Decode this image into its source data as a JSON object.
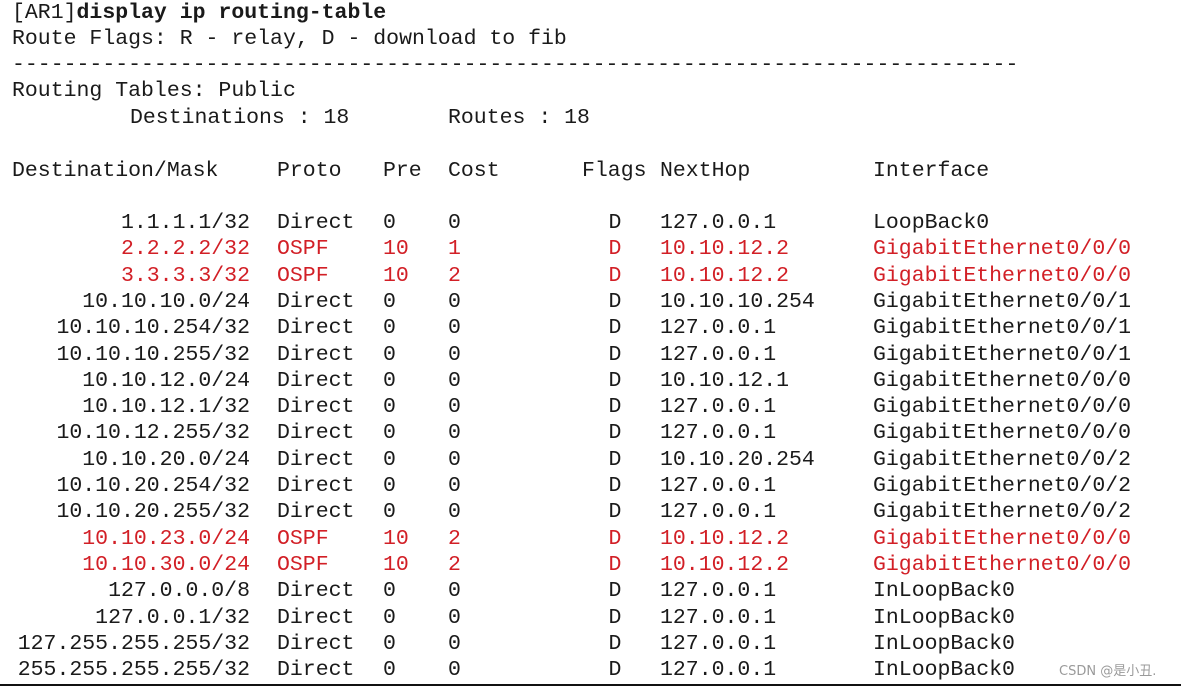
{
  "command": {
    "prompt": "[AR1]",
    "text": "display ip routing-table"
  },
  "flags_legend": "Route Flags: R - relay, D - download to fib",
  "separator": "------------------------------------------------------------------------------",
  "routing_tables_label": "Routing Tables: Public",
  "destinations_label": "Destinations : 18",
  "routes_label": "Routes : 18",
  "columns": [
    "Destination/Mask",
    "Proto",
    "Pre",
    "Cost",
    "Flags",
    "NextHop",
    "Interface"
  ],
  "rows": [
    {
      "dest": "1.1.1.1/32",
      "proto": "Direct",
      "pre": "0",
      "cost": "0",
      "flags": "D",
      "nexthop": "127.0.0.1",
      "iface": "LoopBack0",
      "highlight": false
    },
    {
      "dest": "2.2.2.2/32",
      "proto": "OSPF",
      "pre": "10",
      "cost": "1",
      "flags": "D",
      "nexthop": "10.10.12.2",
      "iface": "GigabitEthernet0/0/0",
      "highlight": true
    },
    {
      "dest": "3.3.3.3/32",
      "proto": "OSPF",
      "pre": "10",
      "cost": "2",
      "flags": "D",
      "nexthop": "10.10.12.2",
      "iface": "GigabitEthernet0/0/0",
      "highlight": true
    },
    {
      "dest": "10.10.10.0/24",
      "proto": "Direct",
      "pre": "0",
      "cost": "0",
      "flags": "D",
      "nexthop": "10.10.10.254",
      "iface": "GigabitEthernet0/0/1",
      "highlight": false
    },
    {
      "dest": "10.10.10.254/32",
      "proto": "Direct",
      "pre": "0",
      "cost": "0",
      "flags": "D",
      "nexthop": "127.0.0.1",
      "iface": "GigabitEthernet0/0/1",
      "highlight": false
    },
    {
      "dest": "10.10.10.255/32",
      "proto": "Direct",
      "pre": "0",
      "cost": "0",
      "flags": "D",
      "nexthop": "127.0.0.1",
      "iface": "GigabitEthernet0/0/1",
      "highlight": false
    },
    {
      "dest": "10.10.12.0/24",
      "proto": "Direct",
      "pre": "0",
      "cost": "0",
      "flags": "D",
      "nexthop": "10.10.12.1",
      "iface": "GigabitEthernet0/0/0",
      "highlight": false
    },
    {
      "dest": "10.10.12.1/32",
      "proto": "Direct",
      "pre": "0",
      "cost": "0",
      "flags": "D",
      "nexthop": "127.0.0.1",
      "iface": "GigabitEthernet0/0/0",
      "highlight": false
    },
    {
      "dest": "10.10.12.255/32",
      "proto": "Direct",
      "pre": "0",
      "cost": "0",
      "flags": "D",
      "nexthop": "127.0.0.1",
      "iface": "GigabitEthernet0/0/0",
      "highlight": false
    },
    {
      "dest": "10.10.20.0/24",
      "proto": "Direct",
      "pre": "0",
      "cost": "0",
      "flags": "D",
      "nexthop": "10.10.20.254",
      "iface": "GigabitEthernet0/0/2",
      "highlight": false
    },
    {
      "dest": "10.10.20.254/32",
      "proto": "Direct",
      "pre": "0",
      "cost": "0",
      "flags": "D",
      "nexthop": "127.0.0.1",
      "iface": "GigabitEthernet0/0/2",
      "highlight": false
    },
    {
      "dest": "10.10.20.255/32",
      "proto": "Direct",
      "pre": "0",
      "cost": "0",
      "flags": "D",
      "nexthop": "127.0.0.1",
      "iface": "GigabitEthernet0/0/2",
      "highlight": false
    },
    {
      "dest": "10.10.23.0/24",
      "proto": "OSPF",
      "pre": "10",
      "cost": "2",
      "flags": "D",
      "nexthop": "10.10.12.2",
      "iface": "GigabitEthernet0/0/0",
      "highlight": true
    },
    {
      "dest": "10.10.30.0/24",
      "proto": "OSPF",
      "pre": "10",
      "cost": "2",
      "flags": "D",
      "nexthop": "10.10.12.2",
      "iface": "GigabitEthernet0/0/0",
      "highlight": true
    },
    {
      "dest": "127.0.0.0/8",
      "proto": "Direct",
      "pre": "0",
      "cost": "0",
      "flags": "D",
      "nexthop": "127.0.0.1",
      "iface": "InLoopBack0",
      "highlight": false
    },
    {
      "dest": "127.0.0.1/32",
      "proto": "Direct",
      "pre": "0",
      "cost": "0",
      "flags": "D",
      "nexthop": "127.0.0.1",
      "iface": "InLoopBack0",
      "highlight": false
    },
    {
      "dest": "127.255.255.255/32",
      "proto": "Direct",
      "pre": "0",
      "cost": "0",
      "flags": "D",
      "nexthop": "127.0.0.1",
      "iface": "InLoopBack0",
      "highlight": false
    },
    {
      "dest": "255.255.255.255/32",
      "proto": "Direct",
      "pre": "0",
      "cost": "0",
      "flags": "D",
      "nexthop": "127.0.0.1",
      "iface": "InLoopBack0",
      "highlight": false
    }
  ],
  "watermark": "CSDN @是小丑.",
  "colors": {
    "text": "#1a1a1a",
    "highlight": "#d21f26"
  }
}
